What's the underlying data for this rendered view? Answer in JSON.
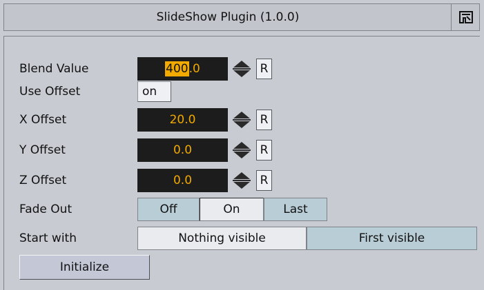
{
  "window": {
    "title": "SlideShow Plugin (1.0.0)"
  },
  "fields": {
    "blend_value": {
      "label": "Blend Value",
      "value_selected": "400",
      "value_rest": ".0",
      "reset": "R"
    },
    "use_offset": {
      "label": "Use Offset",
      "value": "on"
    },
    "x_offset": {
      "label": "X Offset",
      "value": "20.0",
      "reset": "R"
    },
    "y_offset": {
      "label": "Y Offset",
      "value": "0.0",
      "reset": "R"
    },
    "z_offset": {
      "label": "Z Offset",
      "value": "0.0",
      "reset": "R"
    },
    "fade_out": {
      "label": "Fade Out",
      "options": [
        "Off",
        "On",
        "Last"
      ],
      "selected": "On"
    },
    "start_with": {
      "label": "Start with",
      "options": [
        "Nothing visible",
        "First visible"
      ],
      "selected": "Nothing visible"
    }
  },
  "actions": {
    "initialize_label": "Initialize"
  },
  "colors": {
    "panel_bg": "#c8ccd2",
    "field_bg": "#1c1c1c",
    "field_text": "#f2a900",
    "segment_unselected": "#b9cdd6",
    "segment_selected": "#e9ebee",
    "button_bg": "#c3c7d6"
  },
  "icons": {
    "title_button": "plugin-logo-icon",
    "spinner": "spinner-arrows-icon"
  }
}
